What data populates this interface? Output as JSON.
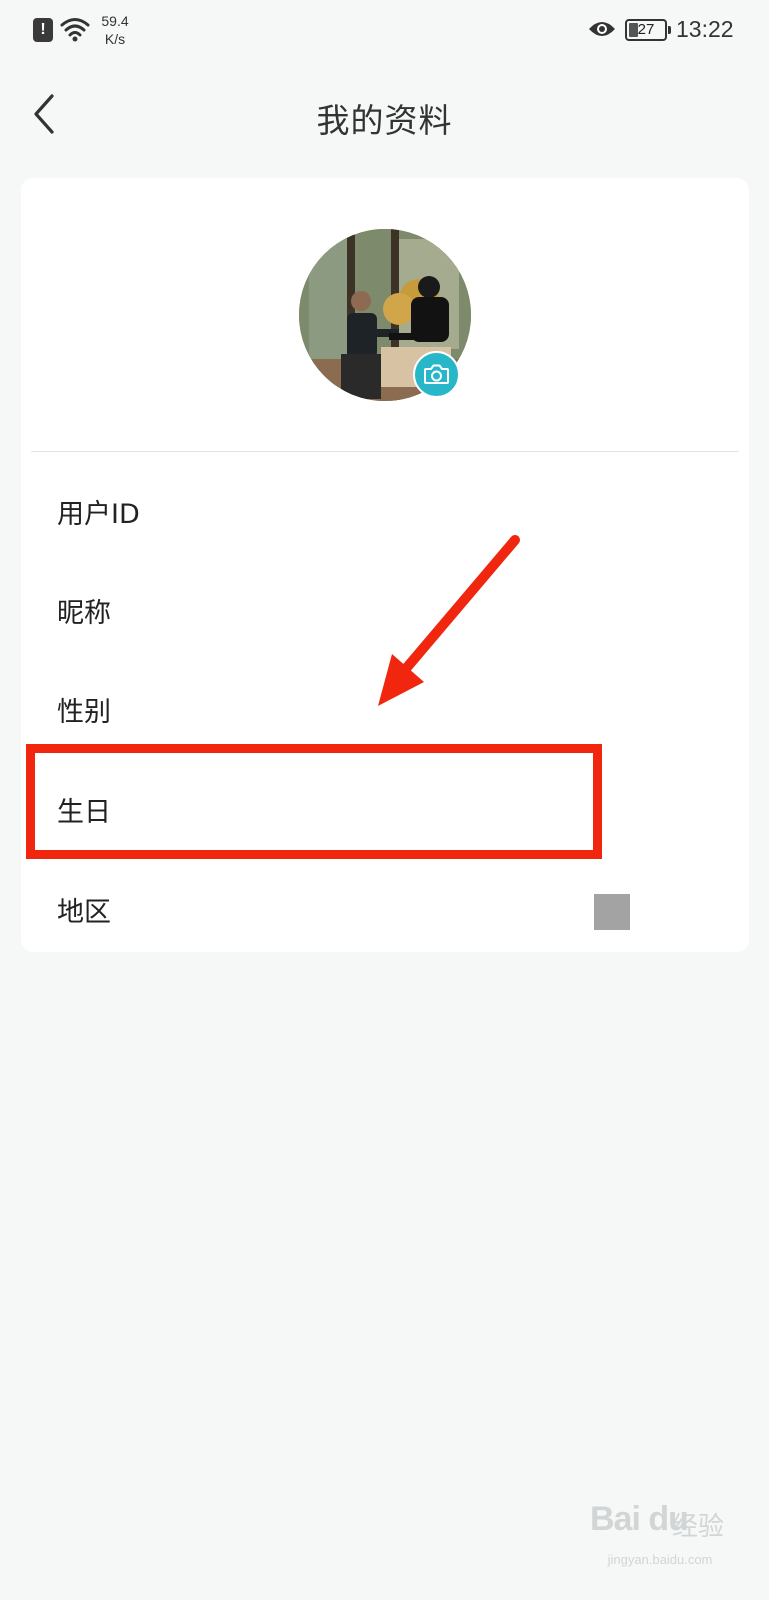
{
  "status_bar": {
    "alert_glyph": "!",
    "net_speed_value": "59.4",
    "net_speed_unit": "K/s",
    "battery_level": "27",
    "time": "13:22",
    "icons": [
      "alert-icon",
      "wifi-icon",
      "eye-icon",
      "battery-icon"
    ]
  },
  "header": {
    "title": "我的资料",
    "back_icon": "chevron-left-icon"
  },
  "profile": {
    "avatar_icon": "avatar-photo",
    "camera_icon": "camera-icon",
    "camera_color": "#27b7c9",
    "rows": [
      {
        "label": "用户ID"
      },
      {
        "label": "昵称"
      },
      {
        "label": "性别"
      },
      {
        "label": "生日"
      },
      {
        "label": "地区"
      }
    ]
  },
  "annotation": {
    "highlight_color": "#f0260f",
    "highlighted_row": "生日"
  },
  "watermark": {
    "logo": "Bai du",
    "cn": "经验",
    "url": "jingyan.baidu.com"
  }
}
